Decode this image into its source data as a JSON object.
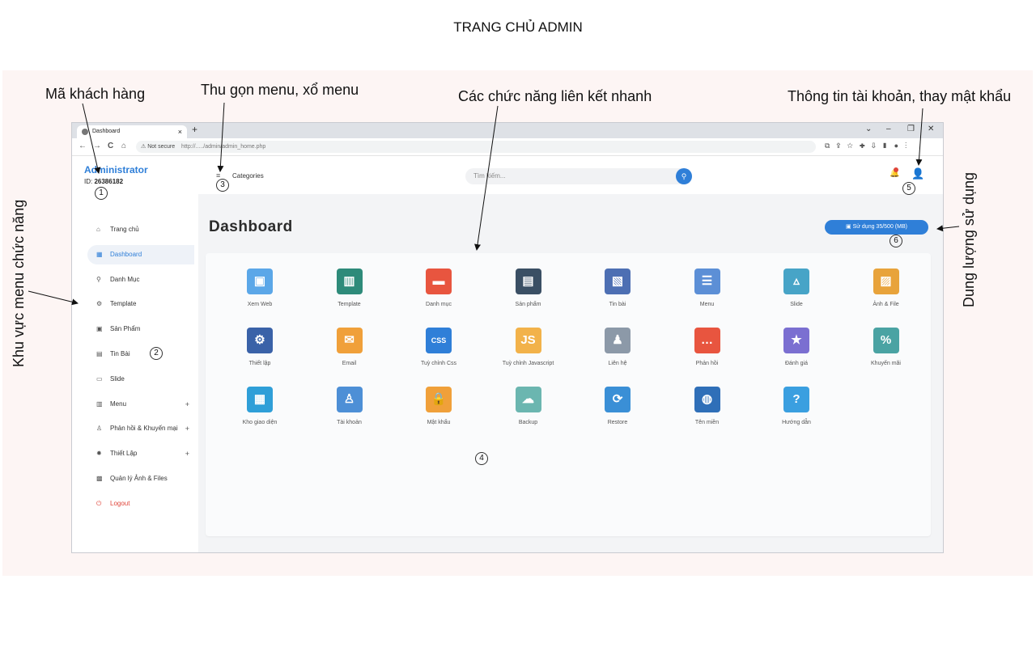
{
  "page_title": "TRANG CHỦ ADMIN",
  "annotations": {
    "customer_id": "Mã khách hàng",
    "collapse_menu": "Thu gọn menu, xổ menu",
    "quick_links": "Các chức năng liên kết nhanh",
    "account_info": "Thông tin tài khoản, thay mật khẩu",
    "menu_area": "Khu vực menu chức năng",
    "usage": "Dung lượng sử dụng"
  },
  "markers": [
    "1",
    "2",
    "3",
    "4",
    "5",
    "6"
  ],
  "browser": {
    "tab_title": "Dashboard",
    "tab_close": "×",
    "new_tab": "+",
    "win_controls": [
      "⌄",
      "–",
      "❐",
      "✕"
    ],
    "nav_buttons": [
      "←",
      "→",
      "C",
      "⌂"
    ],
    "not_secure": "Not secure",
    "url": "http://...../admin/admin_home.php"
  },
  "sidebar": {
    "brand": "Administrator",
    "id_label": "ID: ",
    "id_value": "26386182",
    "items": [
      {
        "label": "Trang chủ",
        "icon": "⌂",
        "plus": ""
      },
      {
        "label": "Dashboard",
        "icon": "▦",
        "plus": ""
      },
      {
        "label": "Danh Mục",
        "icon": "⚲",
        "plus": ""
      },
      {
        "label": "Template",
        "icon": "⚙",
        "plus": ""
      },
      {
        "label": "Sản Phẩm",
        "icon": "▣",
        "plus": ""
      },
      {
        "label": "Tin Bài",
        "icon": "▤",
        "plus": ""
      },
      {
        "label": "Slide",
        "icon": "▭",
        "plus": ""
      },
      {
        "label": "Menu",
        "icon": "▥",
        "plus": "+"
      },
      {
        "label": "Phản hồi & Khuyến mại",
        "icon": "♙",
        "plus": "+"
      },
      {
        "label": "Thiết Lập",
        "icon": "✹",
        "plus": "+"
      },
      {
        "label": "Quản lý Ảnh & Files",
        "icon": "▩",
        "plus": ""
      },
      {
        "label": "Logout",
        "icon": "⏻",
        "plus": ""
      }
    ]
  },
  "topbar": {
    "menu_icon": "≡",
    "categories": "Categories",
    "search_placeholder": "Tìm kiếm...",
    "search_icon": "⚲",
    "bell_icon": "🔔",
    "user_icon": "👤"
  },
  "main": {
    "title": "Dashboard",
    "usage_label": "Sử dụng 35/500 (MB)",
    "tiles": [
      {
        "label": "Xem Web",
        "glyph": "▣",
        "color": "#5ba7e8"
      },
      {
        "label": "Template",
        "glyph": "▥",
        "color": "#2e8b7a"
      },
      {
        "label": "Danh mục",
        "glyph": "▬",
        "color": "#e8553f"
      },
      {
        "label": "Sản phẩm",
        "glyph": "▤",
        "color": "#3a4f64"
      },
      {
        "label": "Tin bài",
        "glyph": "▧",
        "color": "#4d6fb3"
      },
      {
        "label": "Menu",
        "glyph": "☰",
        "color": "#5c8fd6"
      },
      {
        "label": "Slide",
        "glyph": "▵",
        "color": "#47a4c7"
      },
      {
        "label": "Ảnh & File",
        "glyph": "▨",
        "color": "#e8a33b"
      },
      {
        "label": "Thiết lập",
        "glyph": "⚙",
        "color": "#3a62a8"
      },
      {
        "label": "Email",
        "glyph": "✉",
        "color": "#f0a03a"
      },
      {
        "label": "Tuỳ chỉnh Css",
        "glyph": "CSS",
        "color": "#2f7fd8"
      },
      {
        "label": "Tuỳ chỉnh Javascript",
        "glyph": "JS",
        "color": "#f2b24a"
      },
      {
        "label": "Liên hệ",
        "glyph": "♟",
        "color": "#8c99a8"
      },
      {
        "label": "Phản hồi",
        "glyph": "…",
        "color": "#e8553f"
      },
      {
        "label": "Đánh giá",
        "glyph": "★",
        "color": "#7b6fd1"
      },
      {
        "label": "Khuyến mãi",
        "glyph": "%",
        "color": "#4aa3a3"
      },
      {
        "label": "Kho giao diện",
        "glyph": "▦",
        "color": "#2f9fd8"
      },
      {
        "label": "Tài khoản",
        "glyph": "♙",
        "color": "#4d8fd6"
      },
      {
        "label": "Mật khẩu",
        "glyph": "🔒",
        "color": "#f0a03a"
      },
      {
        "label": "Backup",
        "glyph": "☁",
        "color": "#6bb6b0"
      },
      {
        "label": "Restore",
        "glyph": "⟳",
        "color": "#3a8fd6"
      },
      {
        "label": "Tên miền",
        "glyph": "◍",
        "color": "#2f6fb8"
      },
      {
        "label": "Hướng dẫn",
        "glyph": "?",
        "color": "#3a9fe0"
      }
    ]
  }
}
